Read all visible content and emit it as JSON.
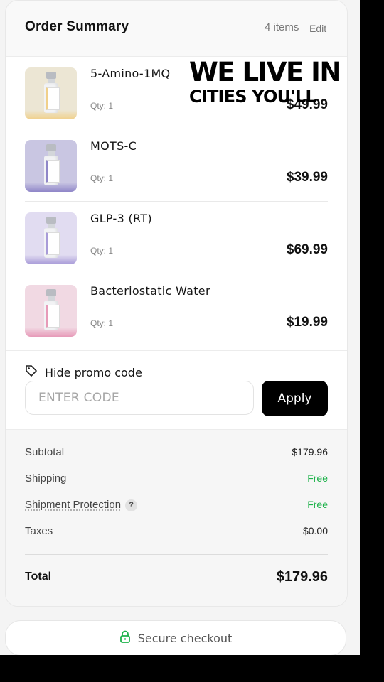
{
  "header": {
    "title": "Order Summary",
    "items_count": "4 items",
    "edit_label": "Edit"
  },
  "items": [
    {
      "name": "5-Amino-1MQ",
      "qty": "Qty: 1",
      "price": "$49.99",
      "thumb_bg": "#ece6d4",
      "thumb_accent": "#f0d08a"
    },
    {
      "name": "MOTS-C",
      "qty": "Qty: 1",
      "price": "$39.99",
      "thumb_bg": "#c9c6e2",
      "thumb_accent": "#8f86c8"
    },
    {
      "name": "GLP-3 (RT)",
      "qty": "Qty: 1",
      "price": "$69.99",
      "thumb_bg": "#e1dcf1",
      "thumb_accent": "#a89bd8"
    },
    {
      "name": "Bacteriostatic Water",
      "qty": "Qty: 1",
      "price": "$19.99",
      "thumb_bg": "#f1d9e3",
      "thumb_accent": "#e79ab8"
    }
  ],
  "overlay_ad": {
    "line1": "WE LIVE IN",
    "line2": "CITIES YOU'LL"
  },
  "promo": {
    "toggle_label": "Hide promo code",
    "input_placeholder": "ENTER CODE",
    "input_value": "",
    "apply_label": "Apply"
  },
  "totals": {
    "subtotal_label": "Subtotal",
    "subtotal_value": "$179.96",
    "shipping_label": "Shipping",
    "shipping_value": "Free",
    "protection_label": "Shipment Protection",
    "protection_help": "?",
    "protection_value": "Free",
    "taxes_label": "Taxes",
    "taxes_value": "$0.00",
    "total_label": "Total",
    "total_value": "$179.96"
  },
  "checkout": {
    "label": "Secure checkout",
    "icon": "lock-icon"
  },
  "colors": {
    "accent_green": "#1db24a",
    "button_black": "#000000"
  }
}
